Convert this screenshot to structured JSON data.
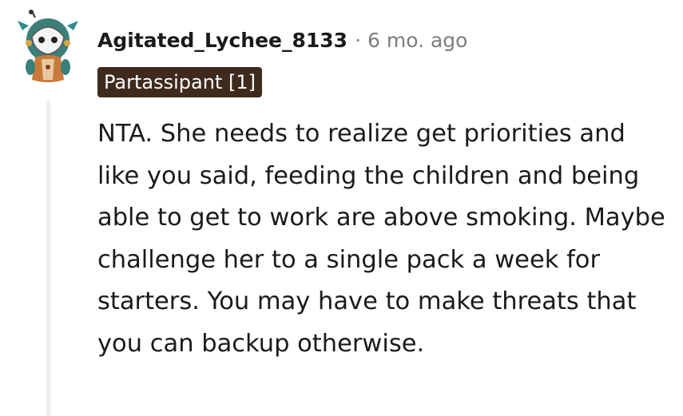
{
  "comment": {
    "author": "Agitated_Lychee_8133",
    "separator": "·",
    "timestamp": "6 mo. ago",
    "flair": "Partassipant [1]",
    "body": "NTA. She needs to realize get priorities and like you said, feeding the children and being able to get to work are above smoking. Maybe challenge her to a single pack a week for starters. You may have to make threats that you can backup otherwise."
  },
  "colors": {
    "flair_background": "#3f2a1e",
    "flair_text": "#ffffff",
    "meta_gray": "#7c7c7c",
    "thread_line": "#edeff1"
  },
  "icons": {
    "avatar": "snoo-avatar-icon"
  }
}
